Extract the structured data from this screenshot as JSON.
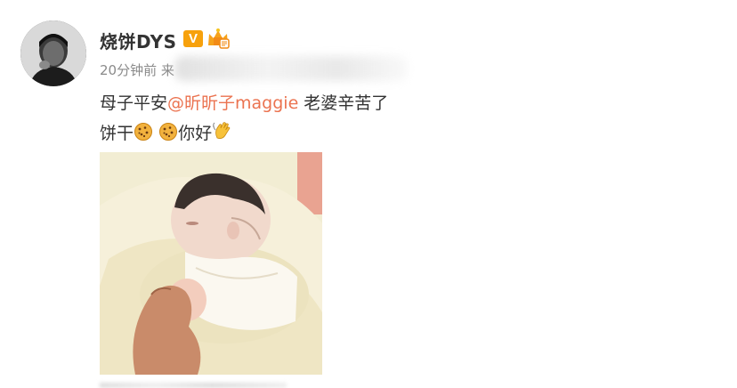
{
  "post": {
    "author": "烧饼DYS",
    "verified_badge": "V",
    "time": "20分钟前 来",
    "text_prefix": "母子平安",
    "mention": "@昕昕子maggie",
    "text_suffix": " 老婆辛苦了",
    "line2_prefix": "饼干",
    "line2_suffix": "你好"
  },
  "icons": {
    "verified": "verified-v-icon",
    "member": "crown-icon",
    "emoji1": "cookie-icon",
    "emoji2": "wave-icon"
  },
  "colors": {
    "mention": "#eb7350",
    "verified": "#f7a10c",
    "text": "#333333",
    "meta": "#8a8a8a"
  }
}
